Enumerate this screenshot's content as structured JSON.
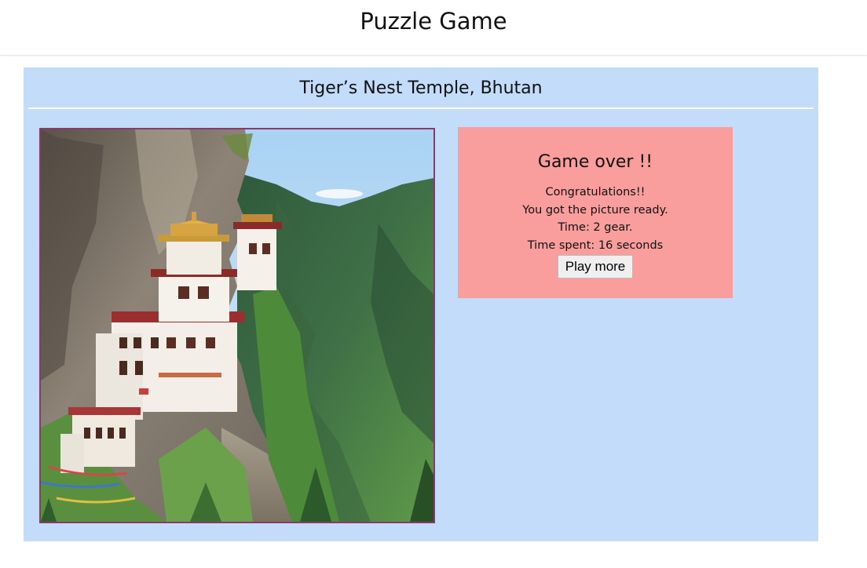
{
  "header": {
    "title": "Puzzle Game"
  },
  "puzzle": {
    "title": "Tiger’s Nest Temple, Bhutan",
    "image_alt": "Tiger’s Nest Temple, Bhutan"
  },
  "result": {
    "heading": "Game over !!",
    "lines": [
      "Congratulations!!",
      "You got the picture ready.",
      "Time: 2 gear.",
      "Time spent: 16 seconds"
    ],
    "play_more_label": "Play more"
  },
  "colors": {
    "panel_background": "#c2dcfa",
    "result_background": "#fa9d9d",
    "board_border": "#8a3a6a"
  }
}
